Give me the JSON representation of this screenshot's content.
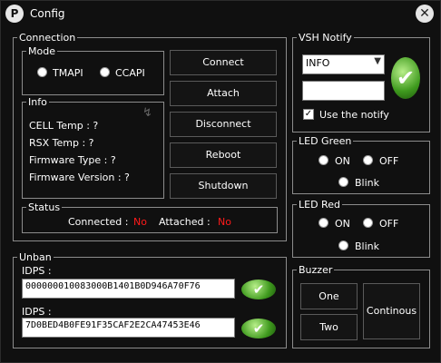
{
  "window": {
    "title": "Config"
  },
  "connection": {
    "legend": "Connection",
    "mode": {
      "legend": "Mode",
      "options": [
        "TMAPI",
        "CCAPI"
      ]
    },
    "info": {
      "legend": "Info",
      "lines": [
        "CELL Temp : ?",
        "RSX Temp : ?",
        "Firmware Type : ?",
        "Firmware Version : ?"
      ]
    },
    "buttons": {
      "connect": "Connect",
      "attach": "Attach",
      "disconnect": "Disconnect",
      "reboot": "Reboot",
      "shutdown": "Shutdown"
    },
    "status": {
      "legend": "Status",
      "connected_label": "Connected :",
      "connected_value": "No",
      "attached_label": "Attached :",
      "attached_value": "No"
    }
  },
  "unban": {
    "legend": "Unban",
    "idps1_label": "IDPS :",
    "idps1_value": "000000010083000B1401B0D946A70F76",
    "idps2_label": "IDPS :",
    "idps2_value": "7D0BED4B0FE91F35CAF2E2CA47453E46"
  },
  "vsh_notify": {
    "legend": "VSH Notify",
    "type_selected": "INFO",
    "message_value": "",
    "use_label": "Use the notify",
    "use_checked": true
  },
  "led_green": {
    "legend": "LED Green",
    "on": "ON",
    "off": "OFF",
    "blink": "Blink"
  },
  "led_red": {
    "legend": "LED Red",
    "on": "ON",
    "off": "OFF",
    "blink": "Blink"
  },
  "buzzer": {
    "legend": "Buzzer",
    "one": "One",
    "two": "Two",
    "continous": "Continous"
  },
  "colors": {
    "background": "#101010",
    "border": "#8c8c8c",
    "status_no": "#ff1a1a",
    "check_green": "#3f9a1e"
  }
}
